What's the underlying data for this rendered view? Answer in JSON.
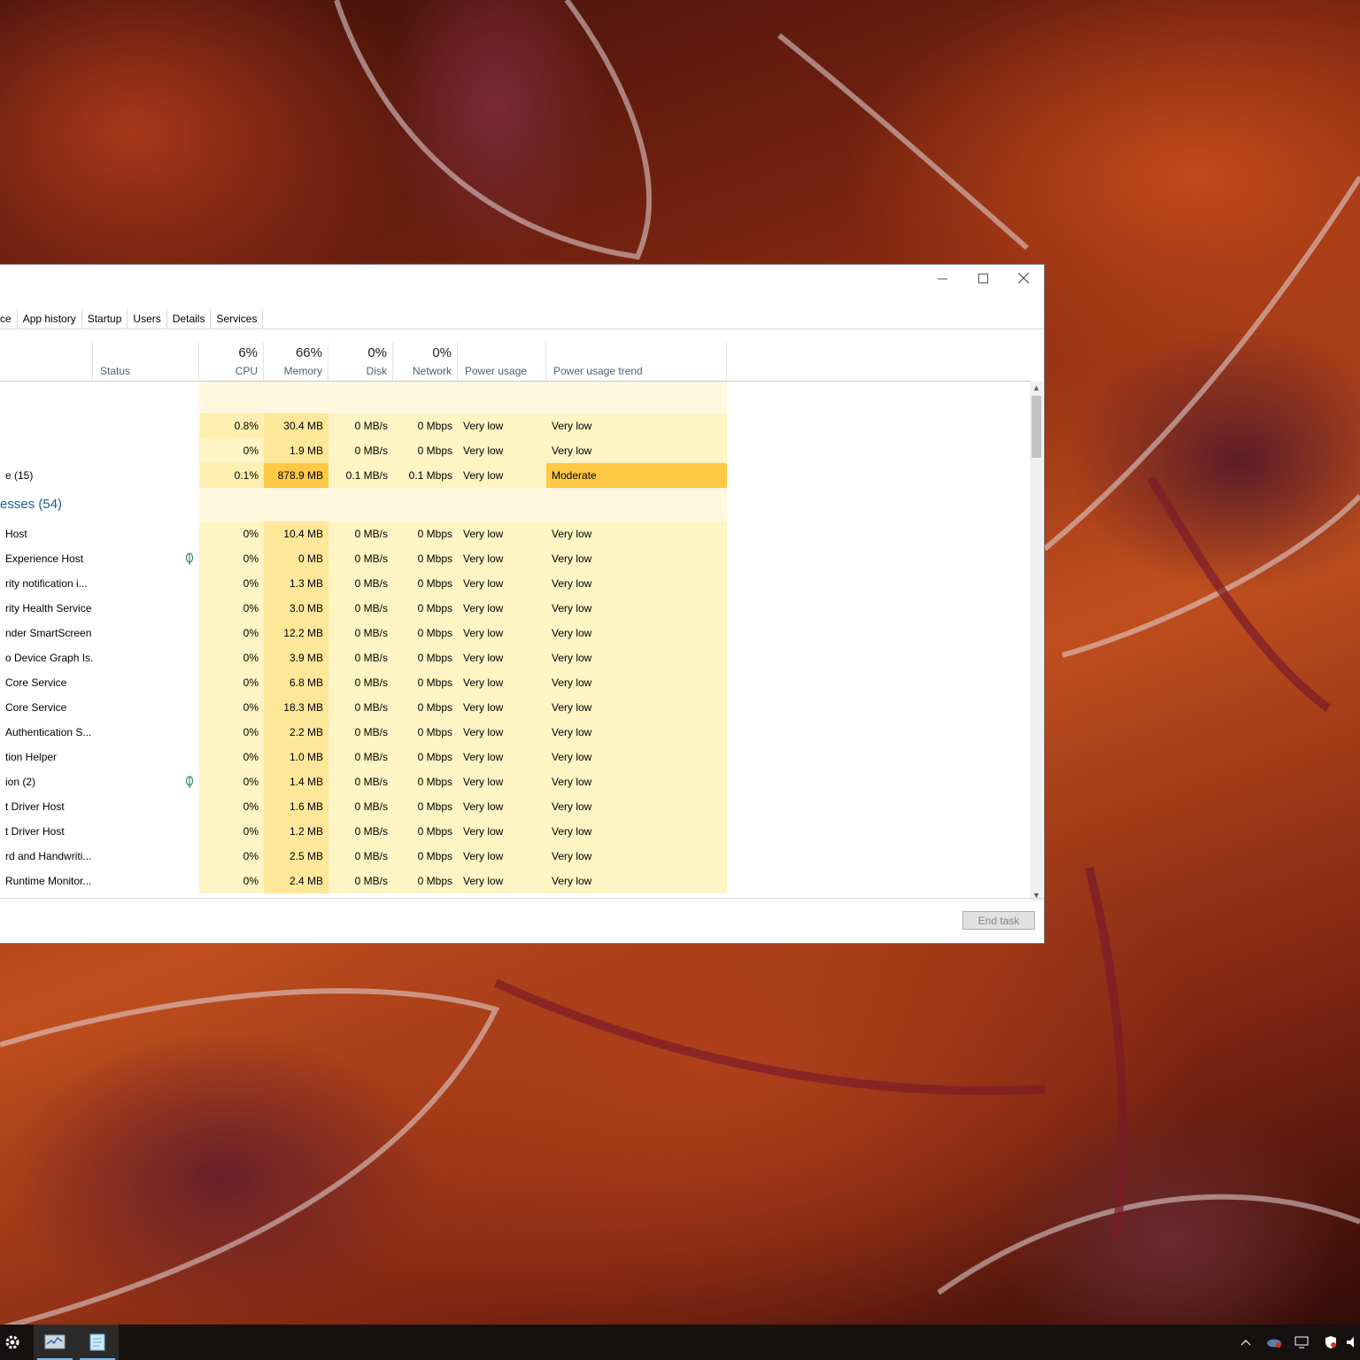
{
  "window": {
    "caption": {
      "minimize_icon": "minimize-icon",
      "maximize_icon": "maximize-icon",
      "close_icon": "close-icon"
    },
    "tabs": [
      {
        "label": "ce"
      },
      {
        "label": "App history"
      },
      {
        "label": "Startup"
      },
      {
        "label": "Users"
      },
      {
        "label": "Details"
      },
      {
        "label": "Services"
      }
    ],
    "columns": {
      "status": {
        "label": "Status"
      },
      "cpu": {
        "pct": "6%",
        "label": "CPU"
      },
      "memory": {
        "pct": "66%",
        "label": "Memory"
      },
      "disk": {
        "pct": "0%",
        "label": "Disk"
      },
      "network": {
        "pct": "0%",
        "label": "Network"
      },
      "power": {
        "label": "Power usage"
      },
      "trend": {
        "label": "Power usage trend"
      }
    },
    "app_rows": [
      {
        "name": "",
        "cpu": "0.8%",
        "mem": "30.4 MB",
        "disk": "0 MB/s",
        "net": "0 Mbps",
        "power": "Very low",
        "trend": "Very low"
      },
      {
        "name": "",
        "cpu": "0%",
        "mem": "1.9 MB",
        "disk": "0 MB/s",
        "net": "0 Mbps",
        "power": "Very low",
        "trend": "Very low"
      },
      {
        "name": "e (15)",
        "cpu": "0.1%",
        "mem": "878.9 MB",
        "disk": "0.1 MB/s",
        "net": "0.1 Mbps",
        "power": "Very low",
        "trend": "Moderate"
      }
    ],
    "group_title": "esses (54)",
    "bg_rows": [
      {
        "name": "Host",
        "leaf": false,
        "cpu": "0%",
        "mem": "10.4 MB",
        "disk": "0 MB/s",
        "net": "0 Mbps",
        "power": "Very low",
        "trend": "Very low"
      },
      {
        "name": "Experience Host",
        "leaf": true,
        "cpu": "0%",
        "mem": "0 MB",
        "disk": "0 MB/s",
        "net": "0 Mbps",
        "power": "Very low",
        "trend": "Very low"
      },
      {
        "name": "rity notification i...",
        "leaf": false,
        "cpu": "0%",
        "mem": "1.3 MB",
        "disk": "0 MB/s",
        "net": "0 Mbps",
        "power": "Very low",
        "trend": "Very low"
      },
      {
        "name": "rity Health Service",
        "leaf": false,
        "cpu": "0%",
        "mem": "3.0 MB",
        "disk": "0 MB/s",
        "net": "0 Mbps",
        "power": "Very low",
        "trend": "Very low"
      },
      {
        "name": "nder SmartScreen",
        "leaf": false,
        "cpu": "0%",
        "mem": "12.2 MB",
        "disk": "0 MB/s",
        "net": "0 Mbps",
        "power": "Very low",
        "trend": "Very low"
      },
      {
        "name": "o Device Graph Is...",
        "leaf": false,
        "cpu": "0%",
        "mem": "3.9 MB",
        "disk": "0 MB/s",
        "net": "0 Mbps",
        "power": "Very low",
        "trend": "Very low"
      },
      {
        "name": "Core Service",
        "leaf": false,
        "cpu": "0%",
        "mem": "6.8 MB",
        "disk": "0 MB/s",
        "net": "0 Mbps",
        "power": "Very low",
        "trend": "Very low"
      },
      {
        "name": "Core Service",
        "leaf": false,
        "cpu": "0%",
        "mem": "18.3 MB",
        "disk": "0 MB/s",
        "net": "0 Mbps",
        "power": "Very low",
        "trend": "Very low"
      },
      {
        "name": "Authentication S...",
        "leaf": false,
        "cpu": "0%",
        "mem": "2.2 MB",
        "disk": "0 MB/s",
        "net": "0 Mbps",
        "power": "Very low",
        "trend": "Very low"
      },
      {
        "name": "tion Helper",
        "leaf": false,
        "cpu": "0%",
        "mem": "1.0 MB",
        "disk": "0 MB/s",
        "net": "0 Mbps",
        "power": "Very low",
        "trend": "Very low"
      },
      {
        "name": "ion (2)",
        "leaf": true,
        "cpu": "0%",
        "mem": "1.4 MB",
        "disk": "0 MB/s",
        "net": "0 Mbps",
        "power": "Very low",
        "trend": "Very low"
      },
      {
        "name": "t Driver Host",
        "leaf": false,
        "cpu": "0%",
        "mem": "1.6 MB",
        "disk": "0 MB/s",
        "net": "0 Mbps",
        "power": "Very low",
        "trend": "Very low"
      },
      {
        "name": "t Driver Host",
        "leaf": false,
        "cpu": "0%",
        "mem": "1.2 MB",
        "disk": "0 MB/s",
        "net": "0 Mbps",
        "power": "Very low",
        "trend": "Very low"
      },
      {
        "name": "rd and Handwriti...",
        "leaf": false,
        "cpu": "0%",
        "mem": "2.5 MB",
        "disk": "0 MB/s",
        "net": "0 Mbps",
        "power": "Very low",
        "trend": "Very low"
      },
      {
        "name": "Runtime Monitor...",
        "leaf": false,
        "cpu": "0%",
        "mem": "2.4 MB",
        "disk": "0 MB/s",
        "net": "0 Mbps",
        "power": "Very low",
        "trend": "Very low"
      }
    ],
    "footer": {
      "end_task_label": "End task"
    }
  },
  "taskbar": {
    "items": [
      {
        "icon": "settings-gear-icon"
      },
      {
        "icon": "task-manager-icon"
      },
      {
        "icon": "notepad-icon"
      }
    ],
    "tray": [
      {
        "icon": "chevron-up-icon"
      },
      {
        "icon": "onedrive-icon"
      },
      {
        "icon": "network-icon"
      },
      {
        "icon": "security-shield-icon"
      },
      {
        "icon": "volume-icon"
      }
    ]
  },
  "colors": {
    "heat_light": "#fff4c4",
    "heat_mid": "#ffefb0",
    "heat_mem": "#ffe79a",
    "heat_moderate": "#ffc845",
    "group_title": "#1f5c99",
    "taskbar": "#141110"
  }
}
